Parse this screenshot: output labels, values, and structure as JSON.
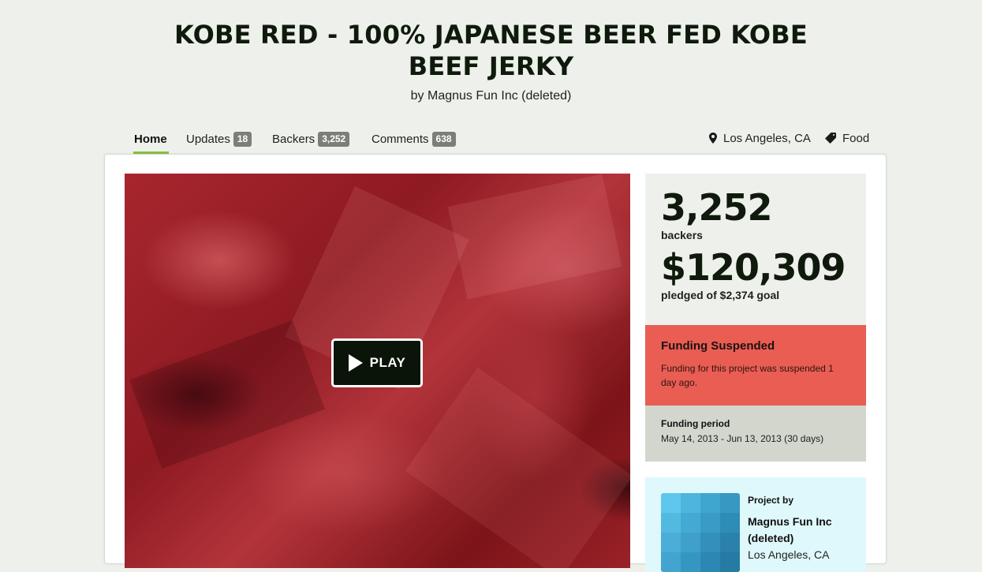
{
  "project": {
    "title": "KOBE RED - 100% JAPANESE BEER FED KOBE BEEF JERKY",
    "byline": "by Magnus Fun Inc (deleted)"
  },
  "tabs": [
    {
      "label": "Home",
      "active": true
    },
    {
      "label": "Updates",
      "count": "18"
    },
    {
      "label": "Backers",
      "count": "3,252"
    },
    {
      "label": "Comments",
      "count": "638"
    }
  ],
  "meta": {
    "location": "Los Angeles, CA",
    "location_icon": "map-pin-icon",
    "category": "Food",
    "category_icon": "tag-icon"
  },
  "video": {
    "play_label": "PLAY",
    "play_icon": "play-icon"
  },
  "stats": {
    "backers": "3,252",
    "backers_label": "backers",
    "pledged": "$120,309",
    "pledged_label": "pledged of $2,374 goal"
  },
  "status": {
    "title": "Funding Suspended",
    "message": "Funding for this project was suspended 1 day ago.",
    "color": "#e95d53"
  },
  "funding_period": {
    "label": "Funding period",
    "value": "May 14, 2013 - Jun 13, 2013 (30 days)"
  },
  "creator": {
    "label": "Project by",
    "name": "Magnus Fun Inc (deleted)",
    "location": "Los Angeles, CA"
  },
  "colors": {
    "accent": "#86c042",
    "background": "#eef1eb",
    "status_suspended": "#e95d53",
    "creator_panel": "#dff8fb"
  }
}
